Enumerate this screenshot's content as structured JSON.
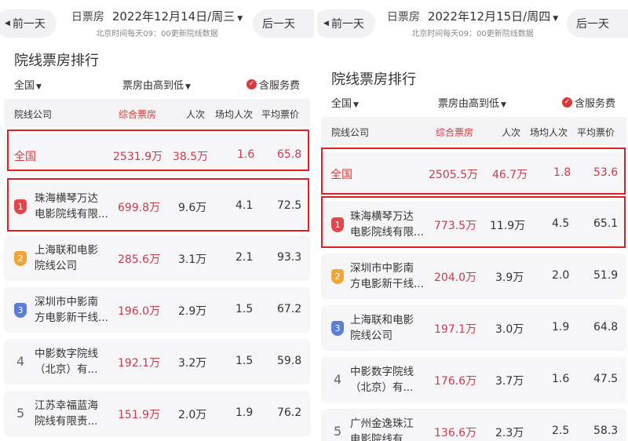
{
  "panels": [
    {
      "prev_label": "前一天",
      "next_label": "后一天",
      "ticket_label": "日票房",
      "date": "2022年12月14日/周三",
      "update_note": "北京时间每天09：00更新院线数据",
      "section_title": "院线票房排行",
      "filter_region": "全国",
      "filter_sort": "票房由高到低",
      "filter_service": "含服务费",
      "columns": [
        "院线公司",
        "综合票房",
        "人次",
        "场均人次",
        "平均票价"
      ],
      "total": {
        "name": "全国",
        "box": "2531.9万",
        "people": "38.5万",
        "avg_people": "1.6",
        "avg_price": "65.8"
      },
      "rows": [
        {
          "rank": "1",
          "name_line1": "珠海横琴万达",
          "name_line2": "电影院线有限...",
          "box": "699.8万",
          "people": "9.6万",
          "avg_people": "4.1",
          "avg_price": "72.5"
        },
        {
          "rank": "2",
          "name_line1": "上海联和电影",
          "name_line2": "院线公司",
          "box": "285.6万",
          "people": "3.1万",
          "avg_people": "2.1",
          "avg_price": "93.3"
        },
        {
          "rank": "3",
          "name_line1": "深圳市中影南",
          "name_line2": "方电影新干线...",
          "box": "196.0万",
          "people": "2.9万",
          "avg_people": "1.5",
          "avg_price": "67.2"
        },
        {
          "rank": "4",
          "name_line1": "中影数字院线",
          "name_line2": "（北京）有...",
          "box": "192.1万",
          "people": "3.2万",
          "avg_people": "1.5",
          "avg_price": "59.8"
        },
        {
          "rank": "5",
          "name_line1": "江苏幸福蓝海",
          "name_line2": "院线有限责...",
          "box": "151.9万",
          "people": "2.0万",
          "avg_people": "1.9",
          "avg_price": "76.2"
        }
      ]
    },
    {
      "prev_label": "前一天",
      "next_label": "后一天",
      "ticket_label": "日票房",
      "date": "2022年12月15日/周四",
      "update_note": "北京时间每天09：00更新院线数据",
      "section_title": "院线票房排行",
      "filter_region": "全国",
      "filter_sort": "票房由高到低",
      "filter_service": "含服务费",
      "columns": [
        "院线公司",
        "综合票房",
        "人次",
        "场均人次",
        "平均票价"
      ],
      "total": {
        "name": "全国",
        "box": "2505.5万",
        "people": "46.7万",
        "avg_people": "1.8",
        "avg_price": "53.6"
      },
      "rows": [
        {
          "rank": "1",
          "name_line1": "珠海横琴万达",
          "name_line2": "电影院线有限...",
          "box": "773.5万",
          "people": "11.9万",
          "avg_people": "4.5",
          "avg_price": "65.1"
        },
        {
          "rank": "2",
          "name_line1": "深圳市中影南",
          "name_line2": "方电影新干线...",
          "box": "204.0万",
          "people": "3.9万",
          "avg_people": "2.0",
          "avg_price": "51.9"
        },
        {
          "rank": "3",
          "name_line1": "上海联和电影",
          "name_line2": "院线公司",
          "box": "197.1万",
          "people": "3.0万",
          "avg_people": "1.9",
          "avg_price": "64.8"
        },
        {
          "rank": "4",
          "name_line1": "中影数字院线",
          "name_line2": "（北京）有...",
          "box": "176.6万",
          "people": "3.7万",
          "avg_people": "1.6",
          "avg_price": "47.5"
        },
        {
          "rank": "5",
          "name_line1": "广州金逸珠江",
          "name_line2": "电影院线有...",
          "box": "136.6万",
          "people": "2.3万",
          "avg_people": "2.5",
          "avg_price": "58.3"
        }
      ]
    }
  ],
  "colors": {
    "accent": "#d9393a",
    "highlight_box": "#e02020",
    "rank1": "#e0464a",
    "rank2": "#f0a53a",
    "rank3": "#5b7fd6"
  }
}
